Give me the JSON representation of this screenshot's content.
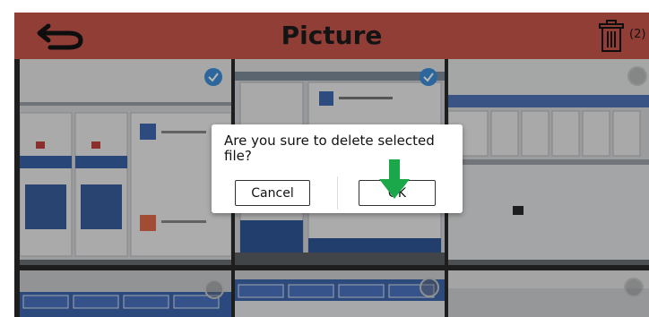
{
  "header": {
    "title": "Picture",
    "back_icon": "back-arrow-icon",
    "trash_icon": "trash-icon",
    "selected_count": "(2)"
  },
  "thumbnails": [
    {
      "selected": true
    },
    {
      "selected": true
    },
    {
      "selected": false
    },
    {
      "selected": false
    },
    {
      "selected": false
    },
    {
      "selected": false
    }
  ],
  "dialog": {
    "message": "Are you sure to delete selected file?",
    "cancel_label": "Cancel",
    "ok_label": "OK"
  },
  "colors": {
    "header": "#c8564c",
    "check": "#3e8ed8",
    "arrow": "#1aa84a"
  }
}
